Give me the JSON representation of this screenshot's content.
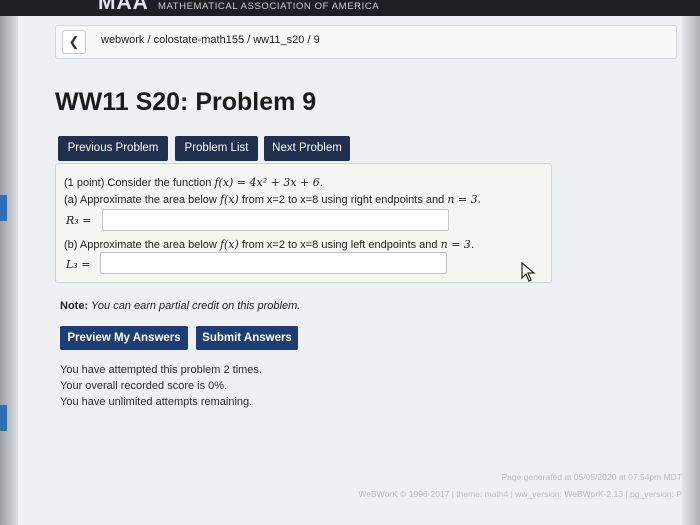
{
  "banner": {
    "logo": "MAA",
    "org": "MATHEMATICAL ASSOCIATION OF AMERICA"
  },
  "breadcrumb": {
    "back_icon": "chevron-left-icon",
    "path": "webwork / colostate-math155 / ww11_s20 / 9"
  },
  "page_title": "WW11 S20: Problem 9",
  "nav": {
    "previous": "Previous Problem",
    "list": "Problem List",
    "next": "Next Problem"
  },
  "problem": {
    "intro_prefix": "(1 point) Consider the function",
    "function_expr": "f(x) = 4x² + 3x + 6.",
    "part_a_prefix": "(a) Approximate the area below",
    "part_a_fx": "f(x)",
    "part_a_suffix": "from x=2 to x=8 using right endpoints and",
    "part_a_n": "n = 3.",
    "part_a_label": "R₃ =",
    "part_a_value": "",
    "part_b_prefix": "(b) Approximate the area below",
    "part_b_fx": "f(x)",
    "part_b_suffix": "from x=2 to x=8 using left endpoints and",
    "part_b_n": "n = 3.",
    "part_b_label": "L₃ =",
    "part_b_value": ""
  },
  "note": {
    "label": "Note:",
    "text": "You can earn partial credit on this problem."
  },
  "actions": {
    "preview": "Preview My Answers",
    "submit": "Submit Answers"
  },
  "status": {
    "attempts": "You have attempted this problem 2 times.",
    "score": "Your overall recorded score is 0%.",
    "remaining": "You have unlimited attempts remaining."
  },
  "footer": {
    "generated": "Page generated at 05/05/2020 at 07:54pm MDT",
    "version": "WeBWorK © 1996-2017 | theme: math4 | ww_version: WeBWorK-2.13 | pg_version: P"
  },
  "colors": {
    "nav_button": "#20304e",
    "action_button": "#1f3c75",
    "banner": "#1e1f25"
  }
}
